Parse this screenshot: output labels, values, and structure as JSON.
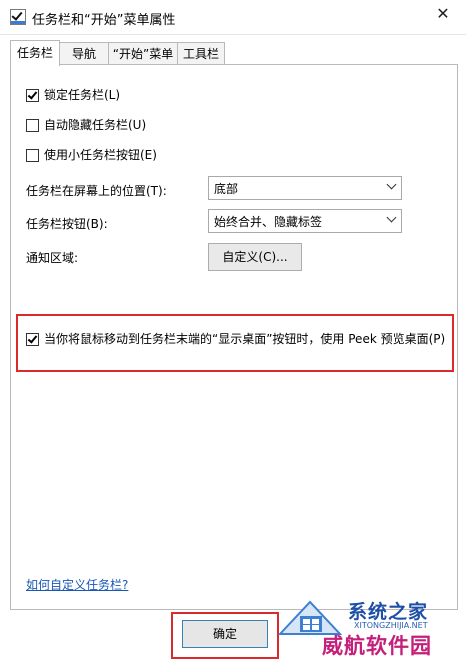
{
  "window": {
    "title": "任务栏和“开始”菜单属性",
    "close_glyph": "✕"
  },
  "tabs": [
    {
      "label": "任务栏",
      "active": true
    },
    {
      "label": "导航",
      "active": false
    },
    {
      "label": "“开始”菜单",
      "active": false
    },
    {
      "label": "工具栏",
      "active": false
    }
  ],
  "options": {
    "lock_taskbar": {
      "label": "锁定任务栏(L)",
      "checked": true
    },
    "auto_hide": {
      "label": "自动隐藏任务栏(U)",
      "checked": false
    },
    "small_buttons": {
      "label": "使用小任务栏按钮(E)",
      "checked": false
    }
  },
  "position": {
    "label": "任务栏在屏幕上的位置(T):",
    "value": "底部"
  },
  "buttons_setting": {
    "label": "任务栏按钮(B):",
    "value": "始终合并、隐藏标签"
  },
  "notification": {
    "label": "通知区域:",
    "button_label": "自定义(C)..."
  },
  "peek": {
    "label": "当你将鼠标移动到任务栏末端的“显示桌面”按钮时，使用 Peek 预览桌面(P)",
    "checked": true
  },
  "help_link": "如何自定义任务栏?",
  "footer": {
    "ok_label": "确定"
  },
  "watermark": {
    "line1": "系统之家",
    "url": "XITONGZHIJIA.NET",
    "line2": "威航软件园"
  },
  "colors": {
    "highlight": "#d92b2b",
    "link": "#1a57b5",
    "accent": "#3c7fb1"
  }
}
